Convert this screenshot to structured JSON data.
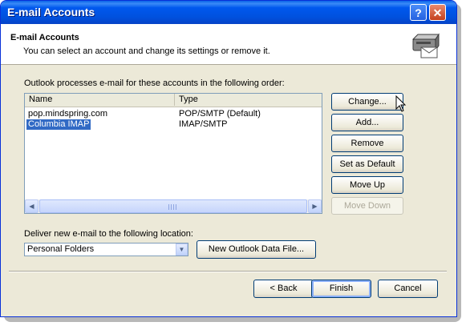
{
  "window": {
    "title": "E-mail Accounts",
    "help_glyph": "?",
    "close_glyph": "✕"
  },
  "header": {
    "title": "E-mail Accounts",
    "subtitle": "You can select an account and change its settings or remove it."
  },
  "accounts": {
    "intro": "Outlook processes e-mail for these accounts in the following order:",
    "columns": {
      "name": "Name",
      "type": "Type"
    },
    "rows": [
      {
        "name": "pop.mindspring.com",
        "type": "POP/SMTP (Default)",
        "selected": false
      },
      {
        "name": "Columbia IMAP",
        "type": "IMAP/SMTP",
        "selected": true
      }
    ]
  },
  "side_buttons": {
    "change": "Change...",
    "add": "Add...",
    "remove": "Remove",
    "set_default": "Set as Default",
    "move_up": "Move Up",
    "move_down": "Move Down"
  },
  "delivery": {
    "label": "Deliver new e-mail to the following location:",
    "selected": "Personal Folders",
    "new_file_button": "New Outlook Data File..."
  },
  "footer": {
    "back": "< Back",
    "finish": "Finish",
    "cancel": "Cancel"
  },
  "icons": {
    "help": "help-icon",
    "close": "close-icon",
    "header": "email-accounts-icon",
    "scroll_left": "scroll-left-arrow-icon",
    "scroll_right": "scroll-right-arrow-icon",
    "dropdown": "chevron-down-icon",
    "cursor": "mouse-pointer-icon"
  },
  "colors": {
    "title_bar": "#0058ee",
    "selection": "#316ac5",
    "dialog_bg": "#ece9d8"
  }
}
